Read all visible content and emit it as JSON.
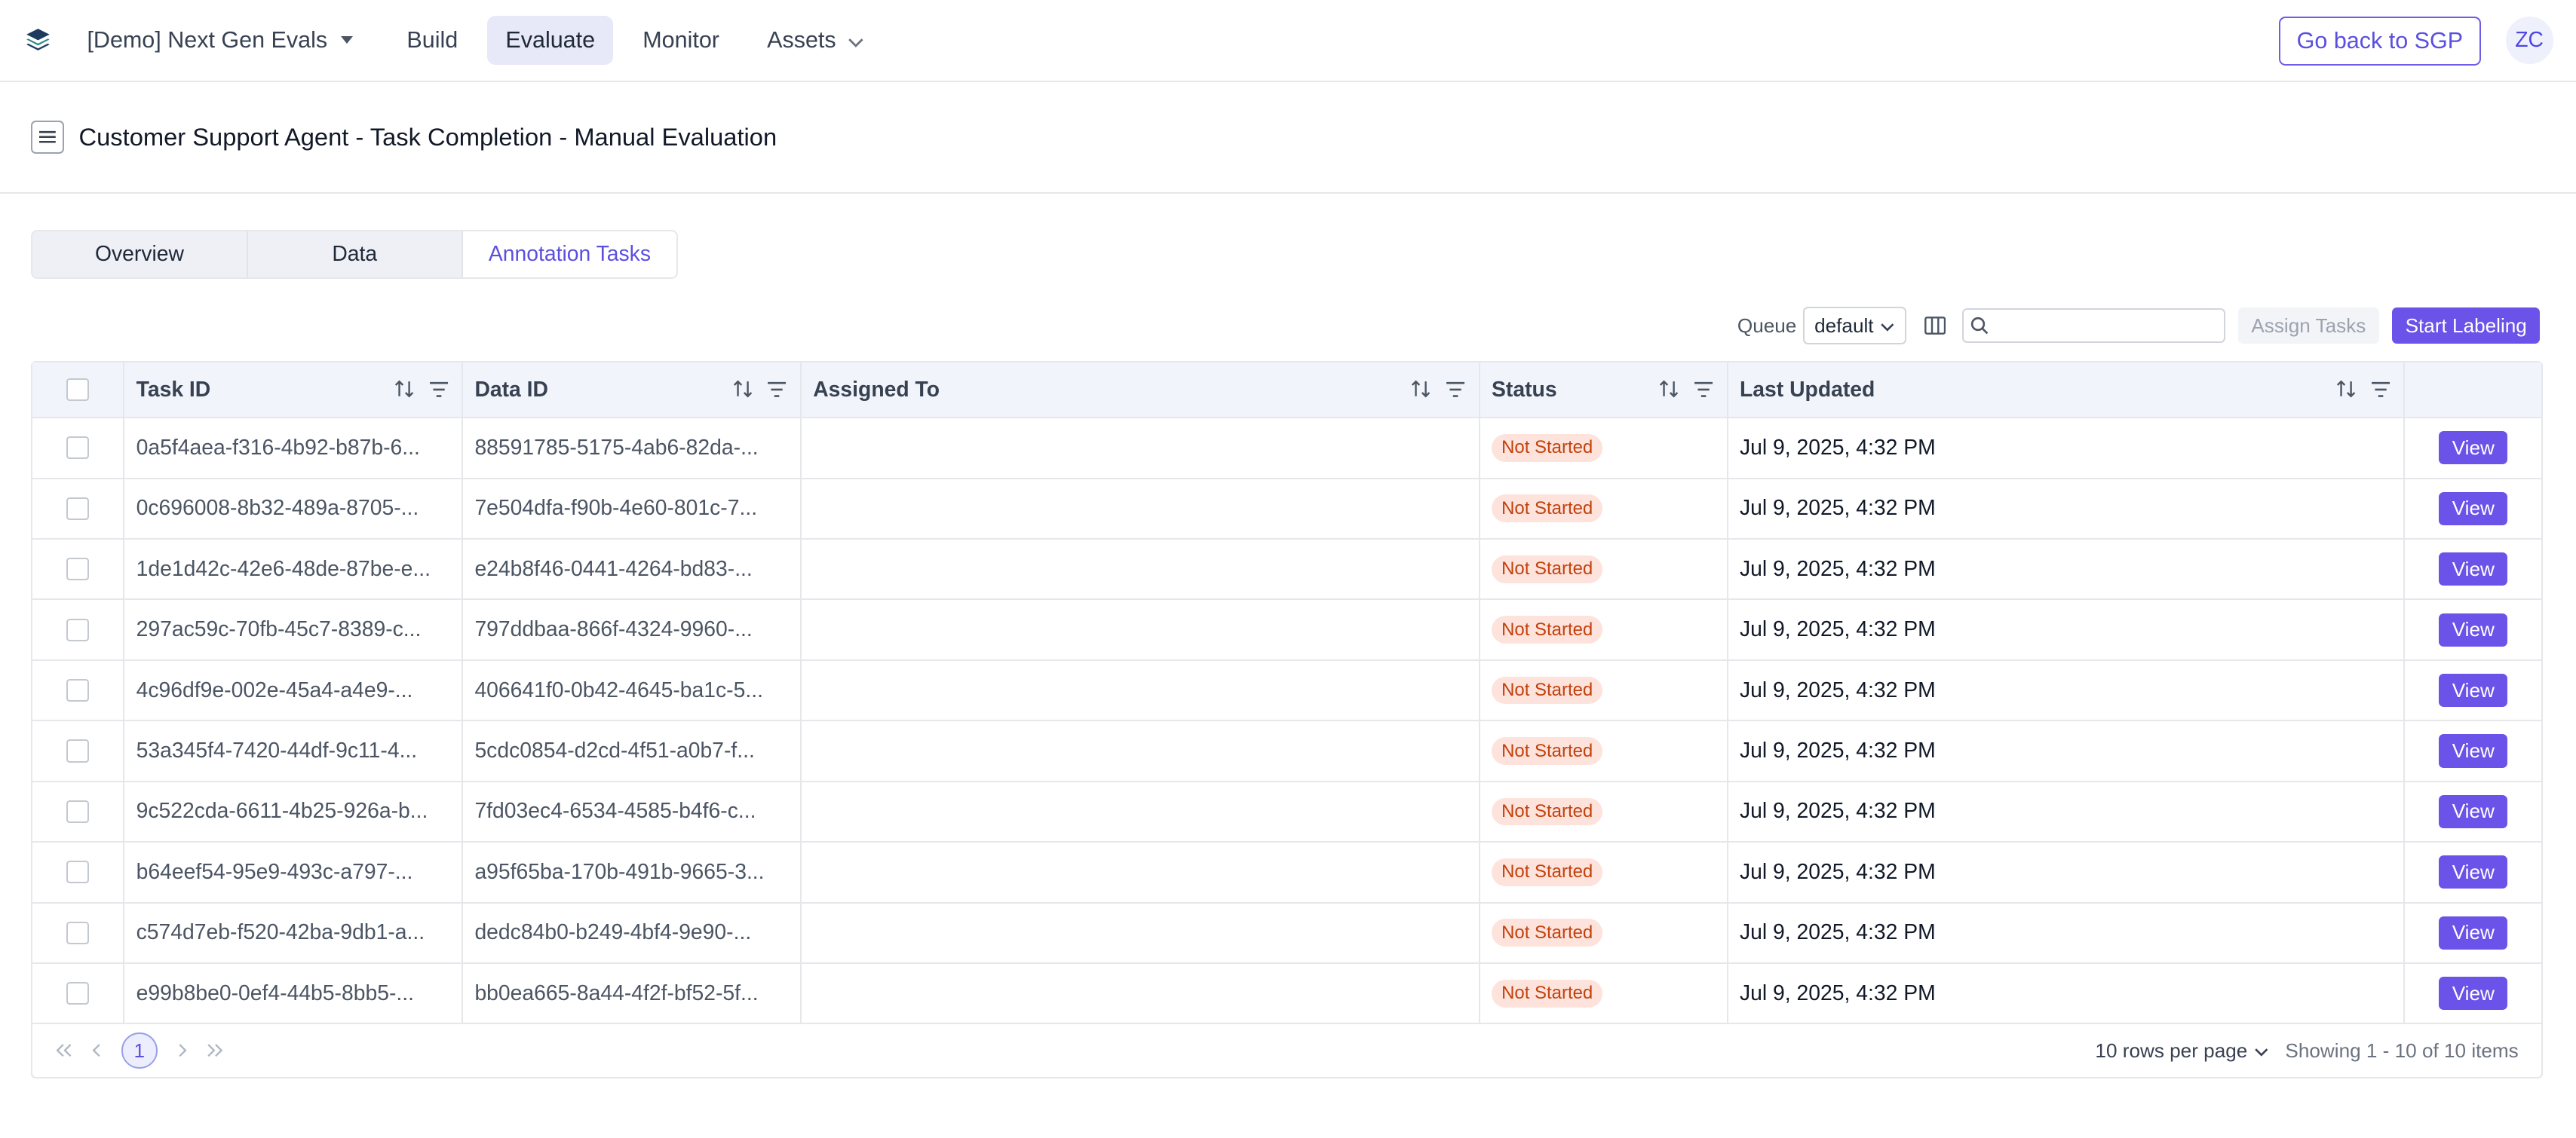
{
  "nav": {
    "project": "[Demo] Next Gen Evals",
    "tabs": [
      {
        "label": "Build"
      },
      {
        "label": "Evaluate"
      },
      {
        "label": "Monitor"
      },
      {
        "label": "Assets"
      }
    ],
    "active_tab": "Evaluate",
    "go_back": "Go back to SGP",
    "avatar": "ZC"
  },
  "page": {
    "title": "Customer Support Agent - Task Completion - Manual Evaluation",
    "tabs": [
      "Overview",
      "Data",
      "Annotation Tasks"
    ],
    "active_tab": "Annotation Tasks"
  },
  "toolbar": {
    "queue_label": "Queue",
    "queue_value": "default",
    "search_placeholder": "",
    "assign_tasks": "Assign Tasks",
    "start_labeling": "Start Labeling"
  },
  "table": {
    "columns": [
      "Task ID",
      "Data ID",
      "Assigned To",
      "Status",
      "Last Updated"
    ],
    "rows": [
      {
        "task_id": "0a5f4aea-f316-4b92-b87b-6...",
        "data_id": "88591785-5175-4ab6-82da-...",
        "assigned_to": "",
        "status": "Not Started",
        "last_updated": "Jul 9, 2025, 4:32 PM",
        "action": "View"
      },
      {
        "task_id": "0c696008-8b32-489a-8705-...",
        "data_id": "7e504dfa-f90b-4e60-801c-7...",
        "assigned_to": "",
        "status": "Not Started",
        "last_updated": "Jul 9, 2025, 4:32 PM",
        "action": "View"
      },
      {
        "task_id": "1de1d42c-42e6-48de-87be-e...",
        "data_id": "e24b8f46-0441-4264-bd83-...",
        "assigned_to": "",
        "status": "Not Started",
        "last_updated": "Jul 9, 2025, 4:32 PM",
        "action": "View"
      },
      {
        "task_id": "297ac59c-70fb-45c7-8389-c...",
        "data_id": "797ddbaa-866f-4324-9960-...",
        "assigned_to": "",
        "status": "Not Started",
        "last_updated": "Jul 9, 2025, 4:32 PM",
        "action": "View"
      },
      {
        "task_id": "4c96df9e-002e-45a4-a4e9-...",
        "data_id": "406641f0-0b42-4645-ba1c-5...",
        "assigned_to": "",
        "status": "Not Started",
        "last_updated": "Jul 9, 2025, 4:32 PM",
        "action": "View"
      },
      {
        "task_id": "53a345f4-7420-44df-9c11-4...",
        "data_id": "5cdc0854-d2cd-4f51-a0b7-f...",
        "assigned_to": "",
        "status": "Not Started",
        "last_updated": "Jul 9, 2025, 4:32 PM",
        "action": "View"
      },
      {
        "task_id": "9c522cda-6611-4b25-926a-b...",
        "data_id": "7fd03ec4-6534-4585-b4f6-c...",
        "assigned_to": "",
        "status": "Not Started",
        "last_updated": "Jul 9, 2025, 4:32 PM",
        "action": "View"
      },
      {
        "task_id": "b64eef54-95e9-493c-a797-...",
        "data_id": "a95f65ba-170b-491b-9665-3...",
        "assigned_to": "",
        "status": "Not Started",
        "last_updated": "Jul 9, 2025, 4:32 PM",
        "action": "View"
      },
      {
        "task_id": "c574d7eb-f520-42ba-9db1-a...",
        "data_id": "dedc84b0-b249-4bf4-9e90-...",
        "assigned_to": "",
        "status": "Not Started",
        "last_updated": "Jul 9, 2025, 4:32 PM",
        "action": "View"
      },
      {
        "task_id": "e99b8be0-0ef4-44b5-8bb5-...",
        "data_id": "bb0ea665-8a44-4f2f-bf52-5f...",
        "assigned_to": "",
        "status": "Not Started",
        "last_updated": "Jul 9, 2025, 4:32 PM",
        "action": "View"
      }
    ]
  },
  "pagination": {
    "current_page": "1",
    "rows_per_page": "10 rows per page",
    "showing": "Showing 1 - 10 of 10 items"
  },
  "colors": {
    "accent": "#6b52e8",
    "status_bg": "#fde3dc",
    "status_text": "#c2410c"
  }
}
